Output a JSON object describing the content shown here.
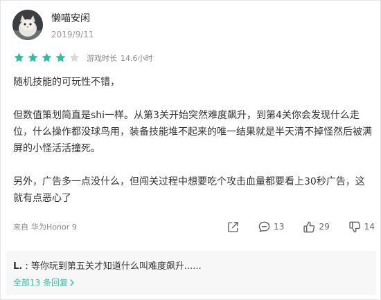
{
  "review": {
    "user": {
      "name": "懒喵安闲",
      "date": "2019/9/11"
    },
    "rating": {
      "filled_stars": 4,
      "max_stars": 5,
      "star_color": "#2bbfa3",
      "empty_star_color": "#d9d9d9"
    },
    "playtime": {
      "label": "游戏时长",
      "value": "14.6小时"
    },
    "paragraphs": [
      "随机技能的可玩性不错，",
      "但数值策划简直是shi一样。从第3关开始突然难度飙升，到第4关你会发现什么走位，什么操作都没球鸟用，装备技能堆不起来的唯一结果就是半天清不掉怪然后被满屏的小怪活活撞死。",
      "另外，广告多一点没什么，但闯关过程中想要吃个攻击血量都要看上30秒广告，这就有点恶心了"
    ],
    "device": {
      "label": "来自",
      "value": "华为Honor 9"
    },
    "actions": {
      "comments": "13",
      "likes": "29",
      "dislikes": "14",
      "icon_color": "#666666"
    },
    "reply": {
      "author": "L.",
      "separator": " : ",
      "text": "等你玩到第五关才知道什么叫难度飙升......",
      "all_replies_label": "全部13 条回复",
      "link_color": "#2bbfa3"
    }
  }
}
